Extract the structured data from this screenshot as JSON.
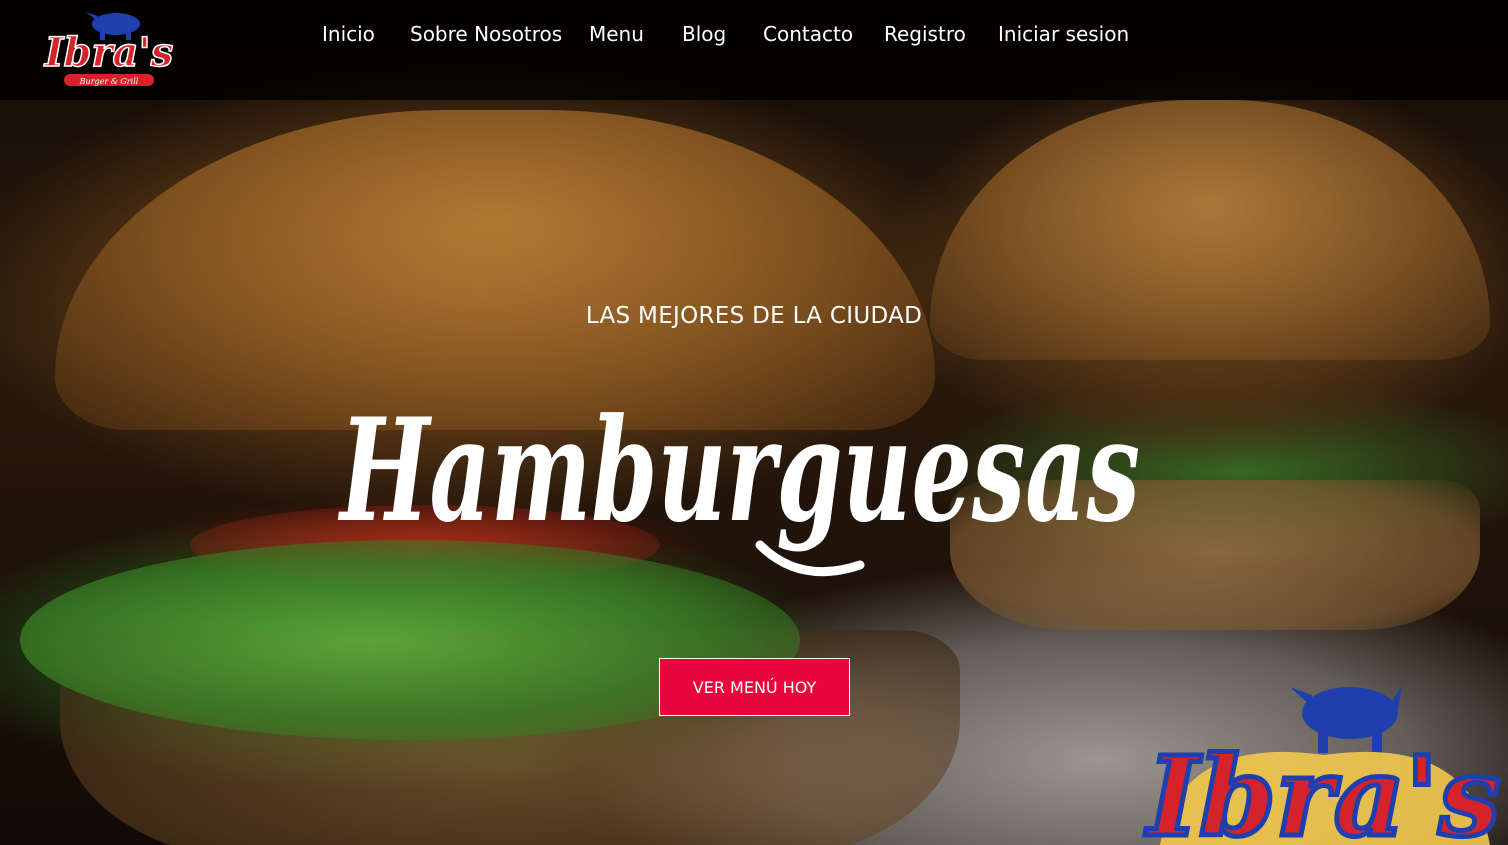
{
  "brand": {
    "name": "Ibra's",
    "tagline": "Burger & Grill",
    "colors": {
      "red": "#d5232b",
      "blue": "#1f3fae",
      "yellow": "#f2c94c"
    },
    "icon": "bull-icon"
  },
  "nav": {
    "items": [
      {
        "label": "Inicio"
      },
      {
        "label": "Sobre Nosotros"
      },
      {
        "label": "Menu"
      },
      {
        "label": "Blog"
      },
      {
        "label": "Contacto"
      },
      {
        "label": "Registro"
      },
      {
        "label": "Iniciar sesion"
      }
    ]
  },
  "hero": {
    "subtitle": "LAS MEJORES DE LA CIUDAD",
    "title": "Hamburguesas",
    "cta_label": "VER MENÚ HOY",
    "cta_color": "#e8063c"
  }
}
